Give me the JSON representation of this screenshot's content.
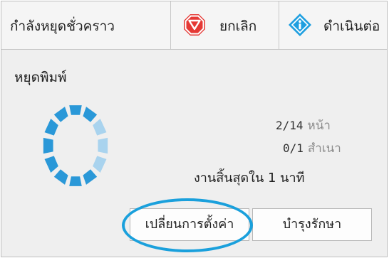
{
  "toolbar": {
    "status": "กำลังหยุดชั่วคราว",
    "cancel_label": "ยกเลิก",
    "continue_label": "ดำเนินต่อ",
    "cancel_icon": "stop-octagon-icon",
    "continue_icon": "continue-diamond-icon",
    "cancel_icon_color": "#e53935",
    "continue_icon_color": "#1f9fe0"
  },
  "main": {
    "title": "หยุดพิมพ์",
    "pages": {
      "value": "2/14",
      "unit": "หน้า"
    },
    "copies": {
      "value": "0/1",
      "unit": "สำเนา"
    },
    "eta": "งานสิ้นสุดใน 1 นาที",
    "spinner_icon": "progress-spinner-icon"
  },
  "buttons": {
    "change_settings": "เปลี่ยนการตั้งค่า",
    "maintenance": "บำรุงรักษา"
  },
  "colors": {
    "accent": "#1aa0dc",
    "spinner_dark": "#2a98d8",
    "spinner_light": "#a9d3ee"
  }
}
